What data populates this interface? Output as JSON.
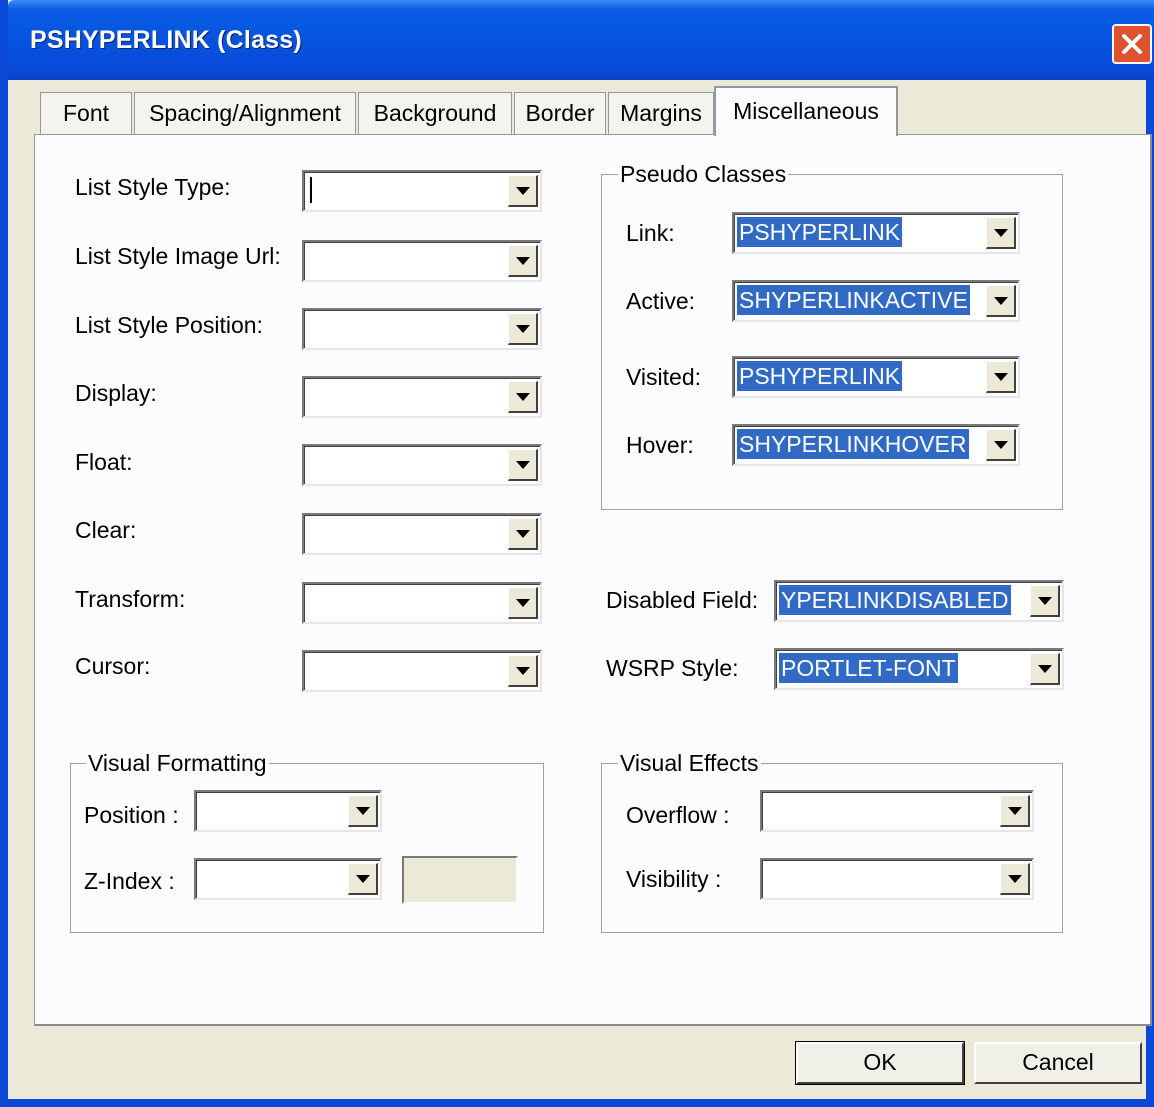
{
  "window": {
    "title": "PSHYPERLINK (Class)"
  },
  "tabs": [
    {
      "label": "Font"
    },
    {
      "label": "Spacing/Alignment"
    },
    {
      "label": "Background"
    },
    {
      "label": "Border"
    },
    {
      "label": "Margins"
    },
    {
      "label": "Miscellaneous"
    }
  ],
  "active_tab": "Miscellaneous",
  "left_fields": {
    "list_style_type": {
      "label": "List Style Type:",
      "value": ""
    },
    "list_style_image_url": {
      "label": "List Style Image Url:",
      "value": ""
    },
    "list_style_position": {
      "label": "List Style Position:",
      "value": ""
    },
    "display": {
      "label": "Display:",
      "value": ""
    },
    "float": {
      "label": "Float:",
      "value": ""
    },
    "clear": {
      "label": "Clear:",
      "value": ""
    },
    "transform": {
      "label": "Transform:",
      "value": ""
    },
    "cursor": {
      "label": "Cursor:",
      "value": ""
    }
  },
  "pseudo_classes": {
    "legend": "Pseudo Classes",
    "link": {
      "label": "Link:",
      "value": "PSHYPERLINK"
    },
    "active": {
      "label": "Active:",
      "value": "SHYPERLINKACTIVE"
    },
    "visited": {
      "label": "Visited:",
      "value": "PSHYPERLINK"
    },
    "hover": {
      "label": "Hover:",
      "value": "SHYPERLINKHOVER"
    }
  },
  "disabled_field": {
    "label": "Disabled Field:",
    "value": "YPERLINKDISABLED"
  },
  "wsrp_style": {
    "label": "WSRP Style:",
    "value": "PORTLET-FONT"
  },
  "visual_formatting": {
    "legend": "Visual Formatting",
    "position": {
      "label": "Position :",
      "value": ""
    },
    "z_index": {
      "label": "Z-Index :",
      "value": ""
    }
  },
  "visual_effects": {
    "legend": "Visual Effects",
    "overflow": {
      "label": "Overflow :",
      "value": ""
    },
    "visibility": {
      "label": "Visibility :",
      "value": ""
    }
  },
  "buttons": {
    "ok": "OK",
    "cancel": "Cancel"
  },
  "colors": {
    "titlebar": "#0a49d8",
    "selection": "#316ac5",
    "dialog_bg": "#ece9d8",
    "close": "#e0512f"
  },
  "icons": {
    "close": "close-x-icon",
    "dropdown": "dropdown-arrow-icon"
  }
}
